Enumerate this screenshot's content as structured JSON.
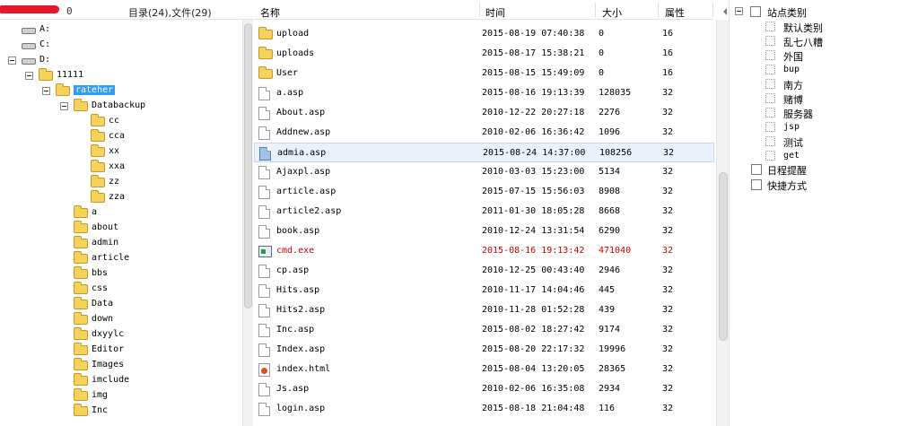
{
  "tree_header": {
    "count_fragment": "0",
    "summary": "目录(24),文件(29)"
  },
  "drives": [
    {
      "label": "A:",
      "level": 1
    },
    {
      "label": "C:",
      "level": 1
    },
    {
      "label": "D:",
      "level": 0
    }
  ],
  "folders": [
    {
      "label": "11111",
      "level": 1,
      "expanded": true
    },
    {
      "label": "rateher",
      "level": 2,
      "expanded": true,
      "selected": true
    },
    {
      "label": "Databackup",
      "level": 3,
      "expanded": true
    },
    {
      "label": "cc",
      "level": 4
    },
    {
      "label": "cca",
      "level": 4
    },
    {
      "label": "xx",
      "level": 4
    },
    {
      "label": "xxa",
      "level": 4
    },
    {
      "label": "zz",
      "level": 4
    },
    {
      "label": "zza",
      "level": 4
    },
    {
      "label": "a",
      "level": 3
    },
    {
      "label": "about",
      "level": 3
    },
    {
      "label": "admin",
      "level": 3
    },
    {
      "label": "article",
      "level": 3
    },
    {
      "label": "bbs",
      "level": 3
    },
    {
      "label": "css",
      "level": 3
    },
    {
      "label": "Data",
      "level": 3
    },
    {
      "label": "down",
      "level": 3
    },
    {
      "label": "dxyylc",
      "level": 3
    },
    {
      "label": "Editor",
      "level": 3
    },
    {
      "label": "Images",
      "level": 3
    },
    {
      "label": "imclude",
      "level": 3
    },
    {
      "label": "img",
      "level": 3
    },
    {
      "label": "Inc",
      "level": 3
    }
  ],
  "list_header": {
    "name": "名称",
    "time": "时间",
    "size": "大小",
    "attr": "属性"
  },
  "files": [
    {
      "name": "upload",
      "time": "2015-08-19 07:40:38",
      "size": "0",
      "attr": "16",
      "icon": "folder-icon"
    },
    {
      "name": "uploads",
      "time": "2015-08-17 15:38:21",
      "size": "0",
      "attr": "16",
      "icon": "folder-icon"
    },
    {
      "name": "User",
      "time": "2015-08-15 15:49:09",
      "size": "0",
      "attr": "16",
      "icon": "folder-icon"
    },
    {
      "name": "a.asp",
      "time": "2015-08-16 19:13:39",
      "size": "128035",
      "attr": "32",
      "icon": "file-icon"
    },
    {
      "name": "About.asp",
      "time": "2010-12-22 20:27:18",
      "size": "2276",
      "attr": "32",
      "icon": "file-icon"
    },
    {
      "name": "Addnew.asp",
      "time": "2010-02-06 16:36:42",
      "size": "1096",
      "attr": "32",
      "icon": "file-icon"
    },
    {
      "name": "admia.asp",
      "time": "2015-08-24 14:37:00",
      "size": "108256",
      "attr": "32",
      "icon": "file-icon-blue",
      "selected": true
    },
    {
      "name": "Ajaxpl.asp",
      "time": "2010-03-03 15:23:00",
      "size": "5134",
      "attr": "32",
      "icon": "file-icon"
    },
    {
      "name": "article.asp",
      "time": "2015-07-15 15:56:03",
      "size": "8908",
      "attr": "32",
      "icon": "file-icon"
    },
    {
      "name": "article2.asp",
      "time": "2011-01-30 18:05:28",
      "size": "8668",
      "attr": "32",
      "icon": "file-icon"
    },
    {
      "name": "book.asp",
      "time": "2010-12-24 13:31:54",
      "size": "6290",
      "attr": "32",
      "icon": "file-icon"
    },
    {
      "name": "cmd.exe",
      "time": "2015-08-16 19:13:42",
      "size": "471040",
      "attr": "32",
      "icon": "exe-icon",
      "highlight": "#c80000"
    },
    {
      "name": "cp.asp",
      "time": "2010-12-25 00:43:40",
      "size": "2946",
      "attr": "32",
      "icon": "file-icon"
    },
    {
      "name": "Hits.asp",
      "time": "2010-11-17 14:04:46",
      "size": "445",
      "attr": "32",
      "icon": "file-icon"
    },
    {
      "name": "Hits2.asp",
      "time": "2010-11-28 01:52:28",
      "size": "439",
      "attr": "32",
      "icon": "file-icon"
    },
    {
      "name": "Inc.asp",
      "time": "2015-08-02 18:27:42",
      "size": "9174",
      "attr": "32",
      "icon": "file-icon"
    },
    {
      "name": "Index.asp",
      "time": "2015-08-20 22:17:32",
      "size": "19996",
      "attr": "32",
      "icon": "file-icon"
    },
    {
      "name": "index.html",
      "time": "2015-08-04 13:20:05",
      "size": "28365",
      "attr": "32",
      "icon": "html-icon"
    },
    {
      "name": "Js.asp",
      "time": "2010-02-06 16:35:08",
      "size": "2934",
      "attr": "32",
      "icon": "file-icon"
    },
    {
      "name": "login.asp",
      "time": "2015-08-18 21:04:48",
      "size": "116",
      "attr": "32",
      "icon": "file-icon"
    }
  ],
  "categories": {
    "root": "站点类别",
    "items": [
      "默认类别",
      "乱七八糟",
      "外国",
      "bup",
      "南方",
      "赌博",
      "服务器",
      "jsp",
      "测试",
      "get"
    ],
    "schedule": "日程提醒",
    "shortcut": "快捷方式"
  },
  "colors": {
    "selection": "#3399ff",
    "row_highlight": "#eaf1fb",
    "danger_text": "#c80000",
    "folder": "#f7d25a"
  }
}
